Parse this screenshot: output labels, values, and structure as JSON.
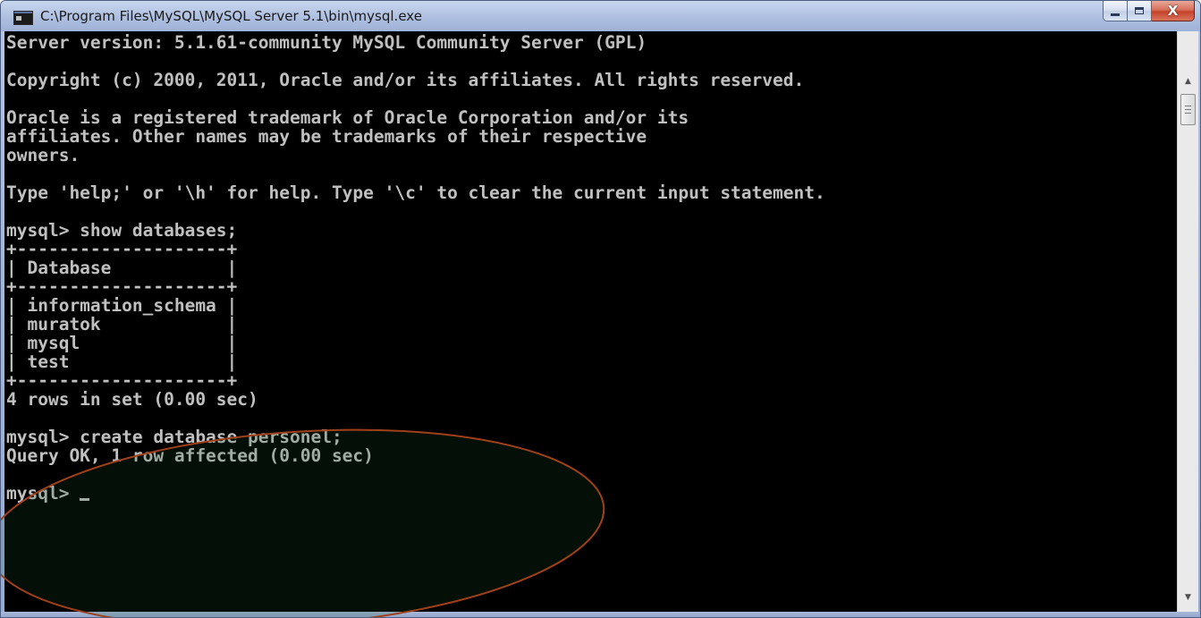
{
  "window": {
    "title": "C:\\Program Files\\MySQL\\MySQL Server 5.1\\bin\\mysql.exe",
    "icon": "console-app-icon",
    "accent_color": "#a6b7d8",
    "close_color": "#c4432a"
  },
  "caption_buttons": {
    "minimize_icon": "minimize-icon",
    "maximize_icon": "maximize-icon",
    "close_icon": "close-icon",
    "close_glyph": "X"
  },
  "console": {
    "background": "#000000",
    "foreground": "#c0c0c0",
    "lines": [
      "Server version: 5.1.61-community MySQL Community Server (GPL)",
      "",
      "Copyright (c) 2000, 2011, Oracle and/or its affiliates. All rights reserved.",
      "",
      "Oracle is a registered trademark of Oracle Corporation and/or its",
      "affiliates. Other names may be trademarks of their respective",
      "owners.",
      "",
      "Type 'help;' or '\\h' for help. Type '\\c' to clear the current input statement.",
      "",
      "mysql> show databases;",
      "+--------------------+",
      "| Database           |",
      "+--------------------+",
      "| information_schema |",
      "| muratok            |",
      "| mysql              |",
      "| test               |",
      "+--------------------+",
      "4 rows in set (0.00 sec)",
      "",
      "mysql> create database personel;",
      "Query OK, 1 row affected (0.00 sec)",
      ""
    ],
    "prompt": "mysql> "
  },
  "annotation": {
    "shape": "ellipse",
    "color": "#a0401a"
  },
  "scrollbar": {
    "up_icon": "scroll-up-arrow-icon",
    "down_icon": "scroll-down-arrow-icon"
  }
}
